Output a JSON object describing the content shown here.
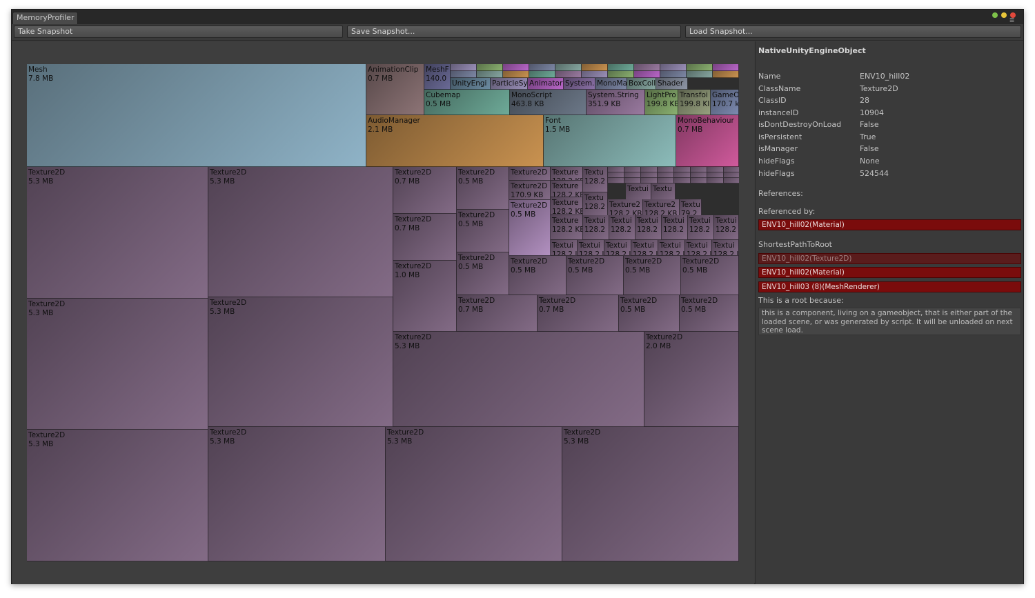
{
  "window": {
    "tab_title": "MemoryProfiler"
  },
  "toolbar": {
    "take_snapshot": "Take Snapshot",
    "save_snapshot": "Save Snapshot...",
    "load_snapshot": "Load Snapshot..."
  },
  "treemap": {
    "cells": [
      {
        "label": "Mesh",
        "size": "7.8 MB",
        "color": "#8fb3c7"
      },
      {
        "label": "AnimationClip",
        "size": "0.7 MB",
        "color": "#8d7476"
      },
      {
        "label": "MeshF",
        "size": "140.0",
        "color": "#6a6a96"
      },
      {
        "label": "UnityEngi",
        "size": "",
        "color": "#6b8aa0"
      },
      {
        "label": "ParticleSy",
        "size": "",
        "color": "#9a8fb8"
      },
      {
        "label": "Animator",
        "size": "",
        "color": "#b866c8"
      },
      {
        "label": "System.E",
        "size": "",
        "color": "#8a70a6"
      },
      {
        "label": "MonoMa",
        "size": "",
        "color": "#7c86a4"
      },
      {
        "label": "BoxColl",
        "size": "",
        "color": "#86a6a0"
      },
      {
        "label": "Shader",
        "size": "",
        "color": "#8e96a6"
      },
      {
        "label": "Cubemap",
        "size": "0.5 MB",
        "color": "#6eaa98"
      },
      {
        "label": "MonoScript",
        "size": "463.8 KB",
        "color": "#6c7888"
      },
      {
        "label": "System.String",
        "size": "351.9 KB",
        "color": "#9a7aa0"
      },
      {
        "label": "LightPro",
        "size": "199.8 KE",
        "color": "#8ab070"
      },
      {
        "label": "Transfoi",
        "size": "199.8 KI",
        "color": "#96a07e"
      },
      {
        "label": "GameO",
        "size": "170.7 k",
        "color": "#7c8ab0"
      },
      {
        "label": "AudioManager",
        "size": "2.1 MB",
        "color": "#c99250"
      },
      {
        "label": "Font",
        "size": "1.5 MB",
        "color": "#8cbcba"
      },
      {
        "label": "MonoBehaviour",
        "size": "0.7 MB",
        "color": "#d05a9c"
      },
      {
        "label": "Texture2D",
        "size": "5.3 MB",
        "color": "#836b86"
      },
      {
        "label": "Texture2D",
        "size": "5.3 MB",
        "color": "#836b86"
      },
      {
        "label": "Texture2D",
        "size": "0.7 MB",
        "color": "#836b86"
      },
      {
        "label": "Texture2D",
        "size": "0.5 MB",
        "color": "#836b86"
      },
      {
        "label": "Texture2D",
        "size": "",
        "color": "#836b86"
      },
      {
        "label": "Texture2D",
        "size": "170.9 KB",
        "color": "#836b86"
      },
      {
        "label": "Texture2D",
        "size": "0.5 MB",
        "color": "#b290c0"
      },
      {
        "label": "Texture2D",
        "size": "0.7 MB",
        "color": "#836b86"
      },
      {
        "label": "Texture2D",
        "size": "0.5 MB",
        "color": "#836b86"
      },
      {
        "label": "Texture2D",
        "size": "1.0 MB",
        "color": "#836b86"
      },
      {
        "label": "Texture2D",
        "size": "0.5 MB",
        "color": "#836b86"
      },
      {
        "label": "Texture2D",
        "size": "0.5 MB",
        "color": "#836b86"
      },
      {
        "label": "Texture2D",
        "size": "0.5 MB",
        "color": "#836b86"
      },
      {
        "label": "Texture2D",
        "size": "0.5 MB",
        "color": "#836b86"
      },
      {
        "label": "Texture2D",
        "size": "0.5 MB",
        "color": "#836b86"
      },
      {
        "label": "Texture2D",
        "size": "0.7 MB",
        "color": "#836b86"
      },
      {
        "label": "Texture2D",
        "size": "0.7 MB",
        "color": "#836b86"
      },
      {
        "label": "Texture2D",
        "size": "0.5 MB",
        "color": "#836b86"
      },
      {
        "label": "Texture2D",
        "size": "0.5 MB",
        "color": "#836b86"
      },
      {
        "label": "Texture2D",
        "size": "5.3 MB",
        "color": "#836b86"
      },
      {
        "label": "Texture2D",
        "size": "5.3 MB",
        "color": "#836b86"
      },
      {
        "label": "Texture2D",
        "size": "5.3 MB",
        "color": "#836b86"
      },
      {
        "label": "Texture2D",
        "size": "2.0 MB",
        "color": "#836b86"
      },
      {
        "label": "Texture2D",
        "size": "5.3 MB",
        "color": "#836b86"
      },
      {
        "label": "Texture2D",
        "size": "5.3 MB",
        "color": "#836b86"
      },
      {
        "label": "Texture2D",
        "size": "5.3 MB",
        "color": "#836b86"
      },
      {
        "label": "Texture2D",
        "size": "5.3 MB",
        "color": "#836b86"
      },
      {
        "label": "Texture",
        "size": "128.2 KB",
        "color": "#836b86"
      },
      {
        "label": "Textu",
        "size": "128.2",
        "color": "#836b86"
      },
      {
        "label": "Texture",
        "size": "128.2 KB",
        "color": "#836b86"
      },
      {
        "label": "Texture",
        "size": "128.2 KB",
        "color": "#836b86"
      },
      {
        "label": "Texture",
        "size": "128.2 KB",
        "color": "#836b86"
      },
      {
        "label": "Textu",
        "size": "128.2",
        "color": "#836b86"
      },
      {
        "label": "Textui",
        "size": "",
        "color": "#836b86"
      },
      {
        "label": "Textu",
        "size": "",
        "color": "#836b86"
      },
      {
        "label": "Texture2",
        "size": "128.2 KB",
        "color": "#836b86"
      },
      {
        "label": "Texture2",
        "size": "128.2 KB",
        "color": "#836b86"
      },
      {
        "label": "Textu",
        "size": "79.2",
        "color": "#836b86"
      },
      {
        "label": "Textui",
        "size": "128.2",
        "color": "#836b86"
      },
      {
        "label": "Textui",
        "size": "128.2",
        "color": "#836b86"
      },
      {
        "label": "Textui",
        "size": "128.2",
        "color": "#836b86"
      },
      {
        "label": "Textui",
        "size": "128.2",
        "color": "#836b86"
      },
      {
        "label": "Textui",
        "size": "128.2",
        "color": "#836b86"
      },
      {
        "label": "Textui",
        "size": "128.2",
        "color": "#836b86"
      },
      {
        "label": "Textui",
        "size": "128.2 I",
        "color": "#836b86"
      },
      {
        "label": "Textui",
        "size": "128.2 I",
        "color": "#836b86"
      },
      {
        "label": "Textui",
        "size": "128.2 I",
        "color": "#836b86"
      },
      {
        "label": "Textui",
        "size": "128.2 I",
        "color": "#836b86"
      },
      {
        "label": "Textui",
        "size": "128.2 I",
        "color": "#836b86"
      },
      {
        "label": "Textui",
        "size": "128.2 I",
        "color": "#836b86"
      },
      {
        "label": "Textui",
        "size": "128.2 I",
        "color": "#836b86"
      }
    ]
  },
  "inspector": {
    "title": "NativeUnityEngineObject",
    "properties": [
      {
        "name": "Name",
        "value": "ENV10_hill02"
      },
      {
        "name": "ClassName",
        "value": "Texture2D"
      },
      {
        "name": "ClassID",
        "value": "28"
      },
      {
        "name": "instanceID",
        "value": "10904"
      },
      {
        "name": "isDontDestroyOnLoad",
        "value": "False"
      },
      {
        "name": "isPersistent",
        "value": "True"
      },
      {
        "name": "isManager",
        "value": "False"
      },
      {
        "name": "hideFlags",
        "value": "None"
      },
      {
        "name": "hideFlags",
        "value": "524544"
      }
    ],
    "references_label": "References:",
    "referenced_by_label": "Referenced by:",
    "referenced_by": [
      "ENV10_hill02(Material)"
    ],
    "shortest_path_label": "ShortestPathToRoot",
    "shortest_path": [
      "ENV10_hill02(Texture2D)",
      "ENV10_hill02(Material)",
      "ENV10_hill03 (8)(MeshRenderer)"
    ],
    "root_reason_label": "This is a root because:",
    "root_reason": "this is a component, living on a gameobject, that is either part of the loaded scene, or was generated by script. It will be unloaded on next scene load."
  }
}
